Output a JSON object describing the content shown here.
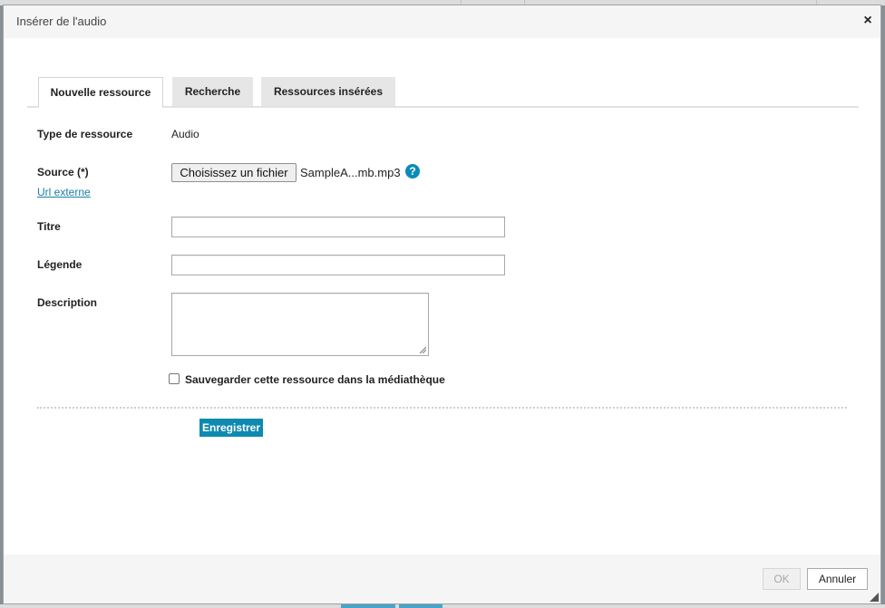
{
  "dialog": {
    "title": "Insérer de l'audio",
    "close_glyph": "×"
  },
  "tabs": [
    {
      "label": "Nouvelle ressource",
      "active": true
    },
    {
      "label": "Recherche",
      "active": false
    },
    {
      "label": "Ressources insérées",
      "active": false
    }
  ],
  "form": {
    "type_label": "Type de ressource",
    "type_value": "Audio",
    "source_label": "Source (*)",
    "file_button_label": "Choisissez un fichier",
    "file_name": "SampleA...mb.mp3",
    "help_glyph": "?",
    "external_url_link": "Url externe",
    "title_label": "Titre",
    "title_value": "",
    "caption_label": "Légende",
    "caption_value": "",
    "description_label": "Description",
    "description_value": "",
    "save_to_library_label": "Sauvegarder cette ressource dans la médiathèque",
    "save_to_library_checked": false,
    "submit_label": "Enregistrer"
  },
  "footer": {
    "ok_label": "OK",
    "ok_disabled": true,
    "cancel_label": "Annuler"
  },
  "colors": {
    "accent": "#0e8ab0",
    "link": "#1a7fa6",
    "help_icon": "#0b8bb8"
  }
}
